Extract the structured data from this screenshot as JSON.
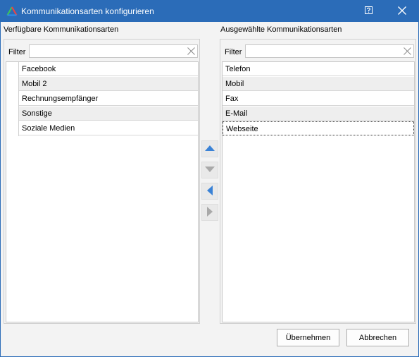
{
  "window": {
    "title": "Kommunikationsarten konfigurieren"
  },
  "left": {
    "header": "Verfügbare Kommunikationsarten",
    "filter_label": "Filter",
    "filter_value": "",
    "items": [
      "Facebook",
      "Mobil 2",
      "Rechnungsempfänger",
      "Sonstige",
      "Soziale Medien"
    ]
  },
  "right": {
    "header": "Ausgewählte Kommunikationsarten",
    "filter_label": "Filter",
    "filter_value": "",
    "items": [
      "Telefon",
      "Mobil",
      "Fax",
      "E-Mail",
      "Webseite"
    ],
    "selected_item": "Webseite"
  },
  "buttons": {
    "ok": "Übernehmen",
    "cancel": "Abbrechen"
  },
  "icons": {
    "app": "app-logo-icon",
    "help": "help-icon",
    "close": "close-icon",
    "clear": "clear-filter-icon",
    "move_up": "arrow-up-icon",
    "move_down": "arrow-down-icon",
    "move_left": "arrow-left-icon",
    "move_right": "arrow-right-icon"
  },
  "colors": {
    "titlebar": "#2b6cb8",
    "arrow_active": "#3a82d6",
    "arrow_disabled": "#a9a9a9"
  }
}
